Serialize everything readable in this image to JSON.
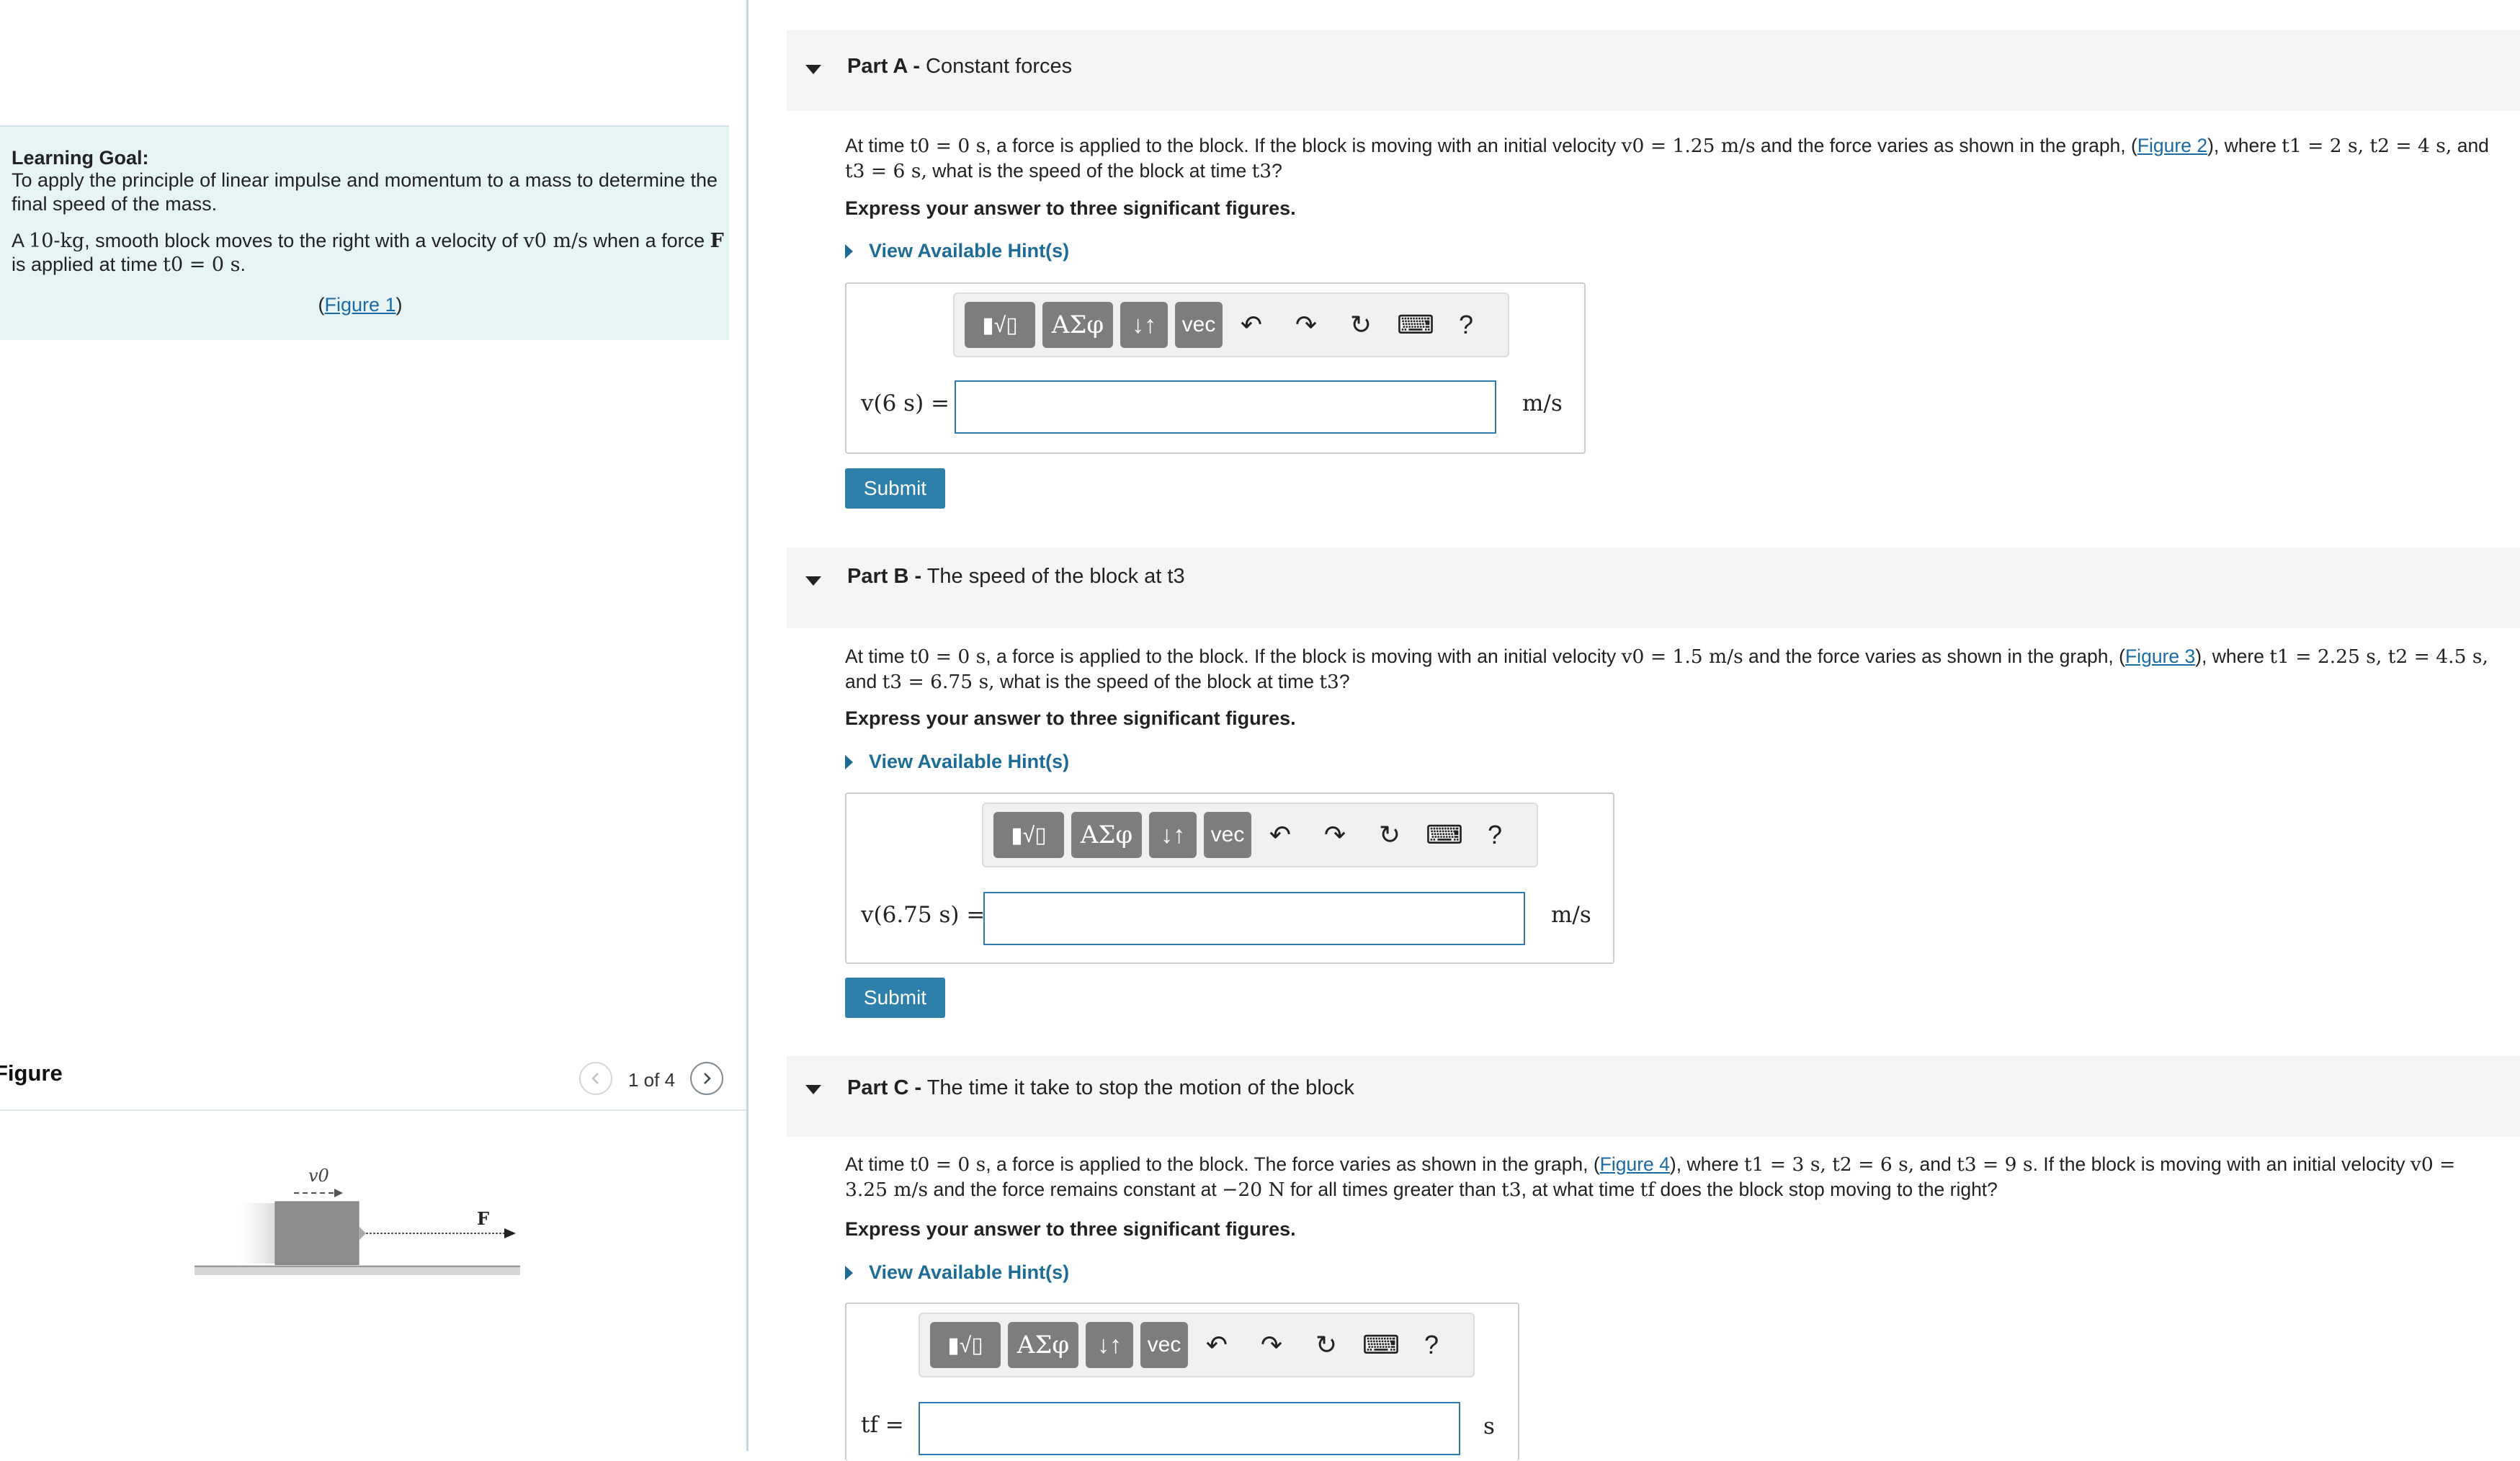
{
  "learning_goal": {
    "heading": "Learning Goal:",
    "text": "To apply the principle of linear impulse and momentum to a mass to determine the final speed of the mass.",
    "para_prefix": "A ",
    "mass": "10-kg",
    "para_mid1": ", smooth block moves to the right with a velocity of ",
    "velocity": "v0 m/s",
    "para_mid2": " when a force ",
    "force": "F",
    "para_mid3": " is applied at time ",
    "time": "t0 = 0 s",
    "para_end": ".",
    "figure_link": "Figure 1"
  },
  "figure_panel": {
    "title": "Figure",
    "pager": "1 of 4",
    "label_v0": "v0",
    "label_F": "F"
  },
  "parts": [
    {
      "label": "Part A -",
      "title": "Constant forces",
      "question": {
        "s1": "At time ",
        "m1": "t0 = 0 s",
        "s2": ", a force is applied to the block. If the block is moving with an initial velocity ",
        "m2": "v0 = 1.25 m/s",
        "s3": " and the force varies as shown in the graph, (",
        "link": "Figure 2",
        "s4": "), where ",
        "m3": "t1 = 2 s, t2 = 4 s,",
        "s5": " and ",
        "m4": "t3 = 6 s,",
        "s6": " what is the speed of the block at time ",
        "m5": "t3",
        "s7": "?"
      },
      "express": "Express your answer to three significant figures.",
      "hint": "View Available Hint(s)",
      "answer_label": "v(6 s) =",
      "answer_value": "",
      "unit": "m/s",
      "submit": "Submit"
    },
    {
      "label": "Part B -",
      "title": "The speed of the block at t3",
      "question": {
        "s1": "At time ",
        "m1": "t0 = 0 s",
        "s2": ", a force is applied to the block. If the block is moving with an initial velocity ",
        "m2": "v0 = 1.5 m/s",
        "s3": " and the force varies as shown in the graph, (",
        "link": "Figure 3",
        "s4": "), where ",
        "m3": "t1 = 2.25 s, t2 = 4.5 s,",
        "s5": " and ",
        "m4": "t3 = 6.75 s,",
        "s6": " what is the speed of the block at time ",
        "m5": "t3",
        "s7": "?"
      },
      "express": "Express your answer to three significant figures.",
      "hint": "View Available Hint(s)",
      "answer_label": "v(6.75 s) =",
      "answer_value": "",
      "unit": "m/s",
      "submit": "Submit"
    },
    {
      "label": "Part C -",
      "title": "The time it take to stop the motion of the block",
      "question": {
        "s1": "At time ",
        "m1": "t0 = 0 s",
        "s2": ", a force is applied to the block. The force varies as shown in the graph, (",
        "link": "Figure 4",
        "s3": "), where ",
        "m2": "t1 = 3 s, t2 = 6 s,",
        "s4": " and ",
        "m3": "t3 = 9 s",
        "s5": ". If the block is moving with an initial velocity ",
        "m4": "v0 = 3.25 m/s",
        "s6": " and the force remains constant at ",
        "m5": "−20 N",
        "s7": " for all times greater than ",
        "m6": "t3",
        "s8": ", at what time ",
        "m7": "tf",
        "s9": " does the block stop moving to the right?"
      },
      "express": "Express your answer to three significant figures.",
      "hint": "View Available Hint(s)",
      "answer_label": "tf =",
      "answer_value": "",
      "unit": "s"
    }
  ],
  "toolbar": {
    "templates_icon": "fraction-sqrt-icon",
    "greek": "ΑΣφ",
    "arrows": "↓↑",
    "vec": "vec",
    "undo_icon": "undo-icon",
    "redo_icon": "redo-icon",
    "reset_icon": "reset-icon",
    "keyboard_icon": "keyboard-icon",
    "help": "?"
  }
}
